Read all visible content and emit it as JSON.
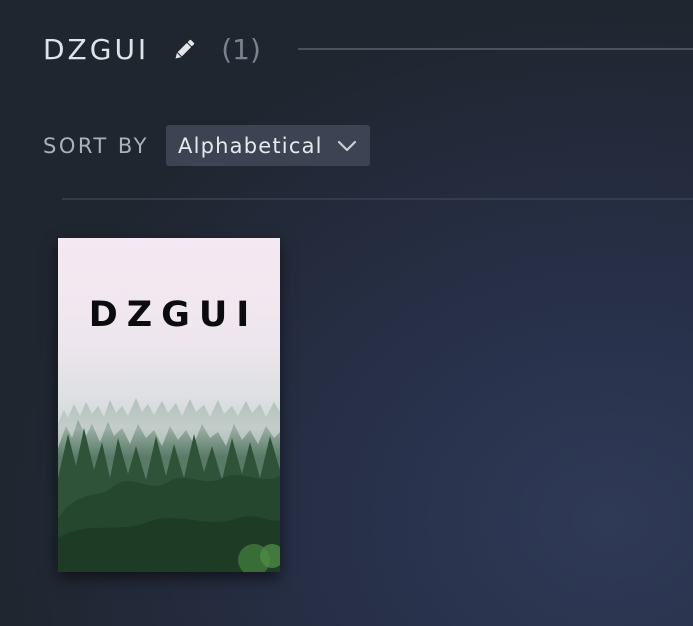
{
  "collection": {
    "title": "DZGUI",
    "count": "(1)",
    "edit_icon": "pencil-icon"
  },
  "sort": {
    "label": "SORT BY",
    "value": "Alphabetical",
    "icon": "chevron-down-icon"
  },
  "games": [
    {
      "title": "DZGUI",
      "art": "misty pine forest under pale pink sky"
    }
  ],
  "colors": {
    "text_primary": "#dfe3ea",
    "text_muted": "#7a8190",
    "dropdown_bg": "#3c4352",
    "background": "#252c3c"
  }
}
